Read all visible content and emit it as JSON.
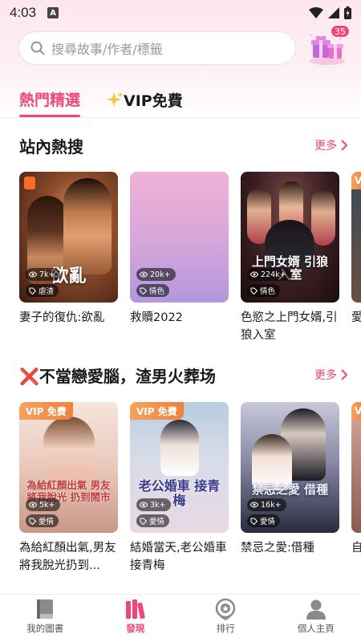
{
  "status": {
    "time": "4:03",
    "notif_letter": "A"
  },
  "search": {
    "placeholder": "搜尋故事/作者/標籤"
  },
  "gift": {
    "badge_count": "35"
  },
  "tabs": [
    {
      "label": "熱門精選",
      "active": true
    },
    {
      "label": "VIP免費",
      "active": false
    }
  ],
  "sections": [
    {
      "title": "站內熱搜",
      "more_label": "更多",
      "books": [
        {
          "title": "妻子的復仇:欲亂",
          "views": "7k+",
          "tag": "虐渣",
          "cover_text": "欲亂",
          "vip": false
        },
        {
          "title": "救贖2022",
          "views": "20k+",
          "tag": "情色",
          "cover_text": "",
          "vip": false
        },
        {
          "title": "色慾之上門女婿,引狼入室",
          "views": "224k+",
          "tag": "情色",
          "cover_text": "上門女婿 引狼入室",
          "vip": false
        },
        {
          "title": "愛",
          "views": "",
          "tag": "",
          "cover_text": "",
          "vip": true,
          "vip_label": "V"
        }
      ]
    },
    {
      "title": "❌不當戀愛腦，渣男火葬场",
      "more_label": "更多",
      "books": [
        {
          "title": "為給紅顏出氣,男友將我脫光扔到...",
          "views": "5k+",
          "tag": "愛情",
          "cover_text": "為給紅顏出氣 男友將我脫光 扔到鬧市",
          "vip": true,
          "vip_label": "VIP 免費"
        },
        {
          "title": "結婚當天,老公婚車接青梅",
          "views": "3k+",
          "tag": "愛情",
          "cover_text": "老公婚車 接青梅",
          "vip": true,
          "vip_label": "VIP 免費"
        },
        {
          "title": "禁忌之愛:借種",
          "views": "16k+",
          "tag": "愛情",
          "cover_text": "禁忌之愛 借種",
          "vip": false
        },
        {
          "title": "自",
          "views": "",
          "tag": "",
          "cover_text": "",
          "vip": true,
          "vip_label": "V"
        }
      ]
    }
  ],
  "nav": [
    {
      "label": "我的圖書",
      "icon": "book-icon",
      "active": false
    },
    {
      "label": "發現",
      "icon": "discover-books-icon",
      "active": true
    },
    {
      "label": "排行",
      "icon": "ranking-medal-icon",
      "active": false
    },
    {
      "label": "個人主頁",
      "icon": "profile-icon",
      "active": false
    }
  ],
  "colors": {
    "accent": "#f0467a",
    "vip": "#f0823c"
  }
}
